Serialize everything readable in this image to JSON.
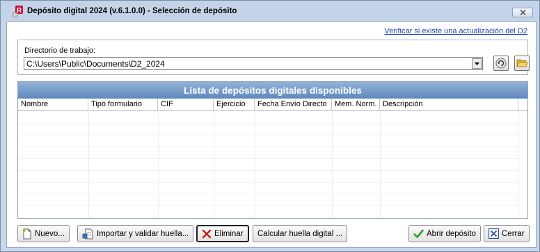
{
  "window": {
    "title": "Depósito digital 2024 (v.6.1.0.0) - Selección de depósito",
    "close_glyph": "✕"
  },
  "update_link": "Verificar si existe una actualización del D2",
  "workdir": {
    "label": "Directorio de trabajo:",
    "value": "C:\\Users\\Public\\Documents\\D2_2024"
  },
  "list": {
    "title": "Lista de depósitos digitales disponibles",
    "columns": [
      "Nombre",
      "Tipo formulario",
      "CIF",
      "Ejercicio",
      "Fecha Envío Directo",
      "Mem. Norm.",
      "Descripción"
    ],
    "rows": []
  },
  "buttons": {
    "new": "Nuevo...",
    "import": "Importar y validar huella...",
    "delete": "Eliminar",
    "calc": "Calcular huella digital ...",
    "open": "Abrir depósito",
    "close": "Cerrar"
  },
  "colors": {
    "header_gradient_top": "#93b3d8",
    "header_gradient_bottom": "#5e88bd",
    "link": "#1d3fb5",
    "titlebar": "#c4d4e8"
  }
}
